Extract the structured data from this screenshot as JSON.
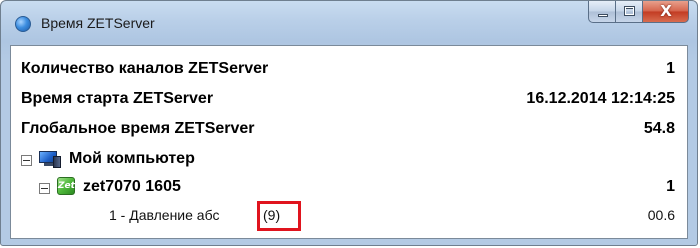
{
  "window": {
    "title": "Время ZETServer",
    "controls": {
      "minimize_icon": "minimize-icon",
      "maximize_icon": "maximize-icon",
      "close_glyph": "X"
    }
  },
  "stats": [
    {
      "label": "Количество каналов ZETServer",
      "value": "1"
    },
    {
      "label": "Время старта ZETServer",
      "value": "16.12.2014 12:14:25"
    },
    {
      "label": "Глобальное время ZETServer",
      "value": "54.8"
    }
  ],
  "tree": {
    "computer": {
      "toggle": "−",
      "icon": "computer-icon",
      "label": "Мой компьютер"
    },
    "device": {
      "toggle": "−",
      "icon": "zet-device-icon",
      "icon_text": "Zet",
      "label": "zet7070 1605",
      "value": "1"
    },
    "channel": {
      "label": "1 - Давление абс",
      "badge": "(9)",
      "value": "00.6"
    }
  },
  "colors": {
    "highlight": "#e0141e",
    "title_gradient_top": "#c9dcf0",
    "close_button": "#c23b22"
  }
}
